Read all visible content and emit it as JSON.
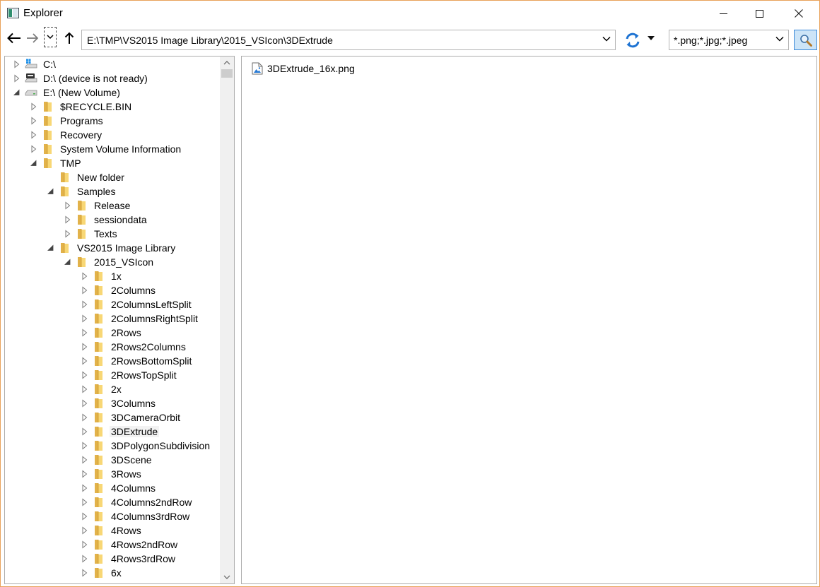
{
  "window": {
    "title": "Explorer"
  },
  "toolbar": {
    "address": "E:\\TMP\\VS2015 Image Library\\2015_VSIcon\\3DExtrude",
    "filter": "*.png;*.jpg;*.jpeg",
    "accent_color": "#1e73d2"
  },
  "tree": {
    "items": [
      {
        "label": "C:\\",
        "depth": 0,
        "expander": "collapsed",
        "icon": "drive-windows-icon"
      },
      {
        "label": "D:\\ (device is not ready)",
        "depth": 0,
        "expander": "collapsed",
        "icon": "drive-dvd-icon"
      },
      {
        "label": "E:\\ (New Volume)",
        "depth": 0,
        "expander": "expanded",
        "icon": "drive-icon"
      },
      {
        "label": "$RECYCLE.BIN",
        "depth": 1,
        "expander": "collapsed",
        "icon": "folder-icon"
      },
      {
        "label": "Programs",
        "depth": 1,
        "expander": "collapsed",
        "icon": "folder-icon"
      },
      {
        "label": "Recovery",
        "depth": 1,
        "expander": "collapsed",
        "icon": "folder-icon"
      },
      {
        "label": "System Volume Information",
        "depth": 1,
        "expander": "collapsed",
        "icon": "folder-icon"
      },
      {
        "label": "TMP",
        "depth": 1,
        "expander": "expanded",
        "icon": "folder-icon"
      },
      {
        "label": "New folder",
        "depth": 2,
        "expander": "none",
        "icon": "folder-icon"
      },
      {
        "label": "Samples",
        "depth": 2,
        "expander": "expanded",
        "icon": "folder-icon"
      },
      {
        "label": "Release",
        "depth": 3,
        "expander": "collapsed",
        "icon": "folder-icon"
      },
      {
        "label": "sessiondata",
        "depth": 3,
        "expander": "collapsed",
        "icon": "folder-icon"
      },
      {
        "label": "Texts",
        "depth": 3,
        "expander": "collapsed",
        "icon": "folder-icon"
      },
      {
        "label": "VS2015 Image Library",
        "depth": 2,
        "expander": "expanded",
        "icon": "folder-icon"
      },
      {
        "label": "2015_VSIcon",
        "depth": 3,
        "expander": "expanded",
        "icon": "folder-icon"
      },
      {
        "label": "1x",
        "depth": 4,
        "expander": "collapsed",
        "icon": "folder-icon"
      },
      {
        "label": "2Columns",
        "depth": 4,
        "expander": "collapsed",
        "icon": "folder-icon"
      },
      {
        "label": "2ColumnsLeftSplit",
        "depth": 4,
        "expander": "collapsed",
        "icon": "folder-icon"
      },
      {
        "label": "2ColumnsRightSplit",
        "depth": 4,
        "expander": "collapsed",
        "icon": "folder-icon"
      },
      {
        "label": "2Rows",
        "depth": 4,
        "expander": "collapsed",
        "icon": "folder-icon"
      },
      {
        "label": "2Rows2Columns",
        "depth": 4,
        "expander": "collapsed",
        "icon": "folder-icon"
      },
      {
        "label": "2RowsBottomSplit",
        "depth": 4,
        "expander": "collapsed",
        "icon": "folder-icon"
      },
      {
        "label": "2RowsTopSplit",
        "depth": 4,
        "expander": "collapsed",
        "icon": "folder-icon"
      },
      {
        "label": "2x",
        "depth": 4,
        "expander": "collapsed",
        "icon": "folder-icon"
      },
      {
        "label": "3Columns",
        "depth": 4,
        "expander": "collapsed",
        "icon": "folder-icon"
      },
      {
        "label": "3DCameraOrbit",
        "depth": 4,
        "expander": "collapsed",
        "icon": "folder-icon"
      },
      {
        "label": "3DExtrude",
        "depth": 4,
        "expander": "collapsed",
        "icon": "folder-icon",
        "selected": true
      },
      {
        "label": "3DPolygonSubdivision",
        "depth": 4,
        "expander": "collapsed",
        "icon": "folder-icon"
      },
      {
        "label": "3DScene",
        "depth": 4,
        "expander": "collapsed",
        "icon": "folder-icon"
      },
      {
        "label": "3Rows",
        "depth": 4,
        "expander": "collapsed",
        "icon": "folder-icon"
      },
      {
        "label": "4Columns",
        "depth": 4,
        "expander": "collapsed",
        "icon": "folder-icon"
      },
      {
        "label": "4Columns2ndRow",
        "depth": 4,
        "expander": "collapsed",
        "icon": "folder-icon"
      },
      {
        "label": "4Columns3rdRow",
        "depth": 4,
        "expander": "collapsed",
        "icon": "folder-icon"
      },
      {
        "label": "4Rows",
        "depth": 4,
        "expander": "collapsed",
        "icon": "folder-icon"
      },
      {
        "label": "4Rows2ndRow",
        "depth": 4,
        "expander": "collapsed",
        "icon": "folder-icon"
      },
      {
        "label": "4Rows3rdRow",
        "depth": 4,
        "expander": "collapsed",
        "icon": "folder-icon"
      },
      {
        "label": "6x",
        "depth": 4,
        "expander": "collapsed",
        "icon": "folder-icon"
      }
    ]
  },
  "files": {
    "items": [
      {
        "label": "3DExtrude_16x.png",
        "icon": "image-file-icon"
      }
    ]
  }
}
